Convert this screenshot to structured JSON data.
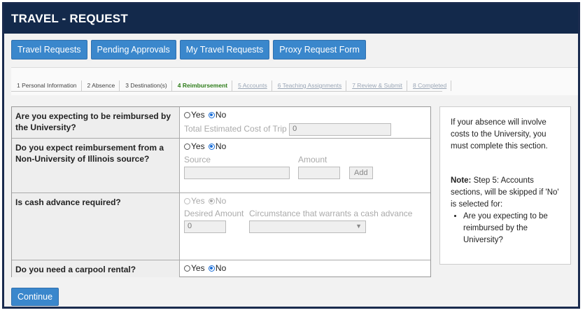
{
  "header": {
    "title": "TRAVEL - REQUEST"
  },
  "nav": {
    "buttons": [
      "Travel Requests",
      "Pending Approvals",
      "My Travel Requests",
      "Proxy Request Form"
    ]
  },
  "steps": [
    {
      "label": "1 Personal Information",
      "state": "done"
    },
    {
      "label": "2 Absence",
      "state": "done"
    },
    {
      "label": "3 Destination(s)",
      "state": "done"
    },
    {
      "label": "4 Reimbursement",
      "state": "active"
    },
    {
      "label": "5 Accounts",
      "state": "disabled"
    },
    {
      "label": "6 Teaching Assignments",
      "state": "disabled"
    },
    {
      "label": "7 Review & Submit",
      "state": "disabled"
    },
    {
      "label": "8 Completed",
      "state": "disabled"
    }
  ],
  "form": {
    "yes": "Yes",
    "no": "No",
    "q1": {
      "question": "Are you expecting to be reimbursed by the University?",
      "selected": "No",
      "cost_label": "Total Estimated Cost of Trip",
      "cost_value": "0"
    },
    "q2": {
      "question": "Do you expect reimbursement from a Non-University of Illinois source?",
      "selected": "No",
      "source_label": "Source",
      "amount_label": "Amount",
      "add_label": "Add"
    },
    "q3": {
      "question": "Is cash advance required?",
      "selected": "No",
      "desired_label": "Desired Amount",
      "desired_value": "0",
      "circumstance_label": "Circumstance that warrants a cash advance"
    },
    "q4": {
      "question": "Do you need a carpool rental?",
      "selected": "No"
    }
  },
  "sidebar": {
    "intro": "If your absence will involve costs to the University, you must complete this section.",
    "note_label": "Note:",
    "note_text": " Step 5: Accounts sections, will be skipped if 'No' is selected for:",
    "bullet": "Are you expecting to be reimbursed by the University?"
  },
  "continue_label": "Continue"
}
